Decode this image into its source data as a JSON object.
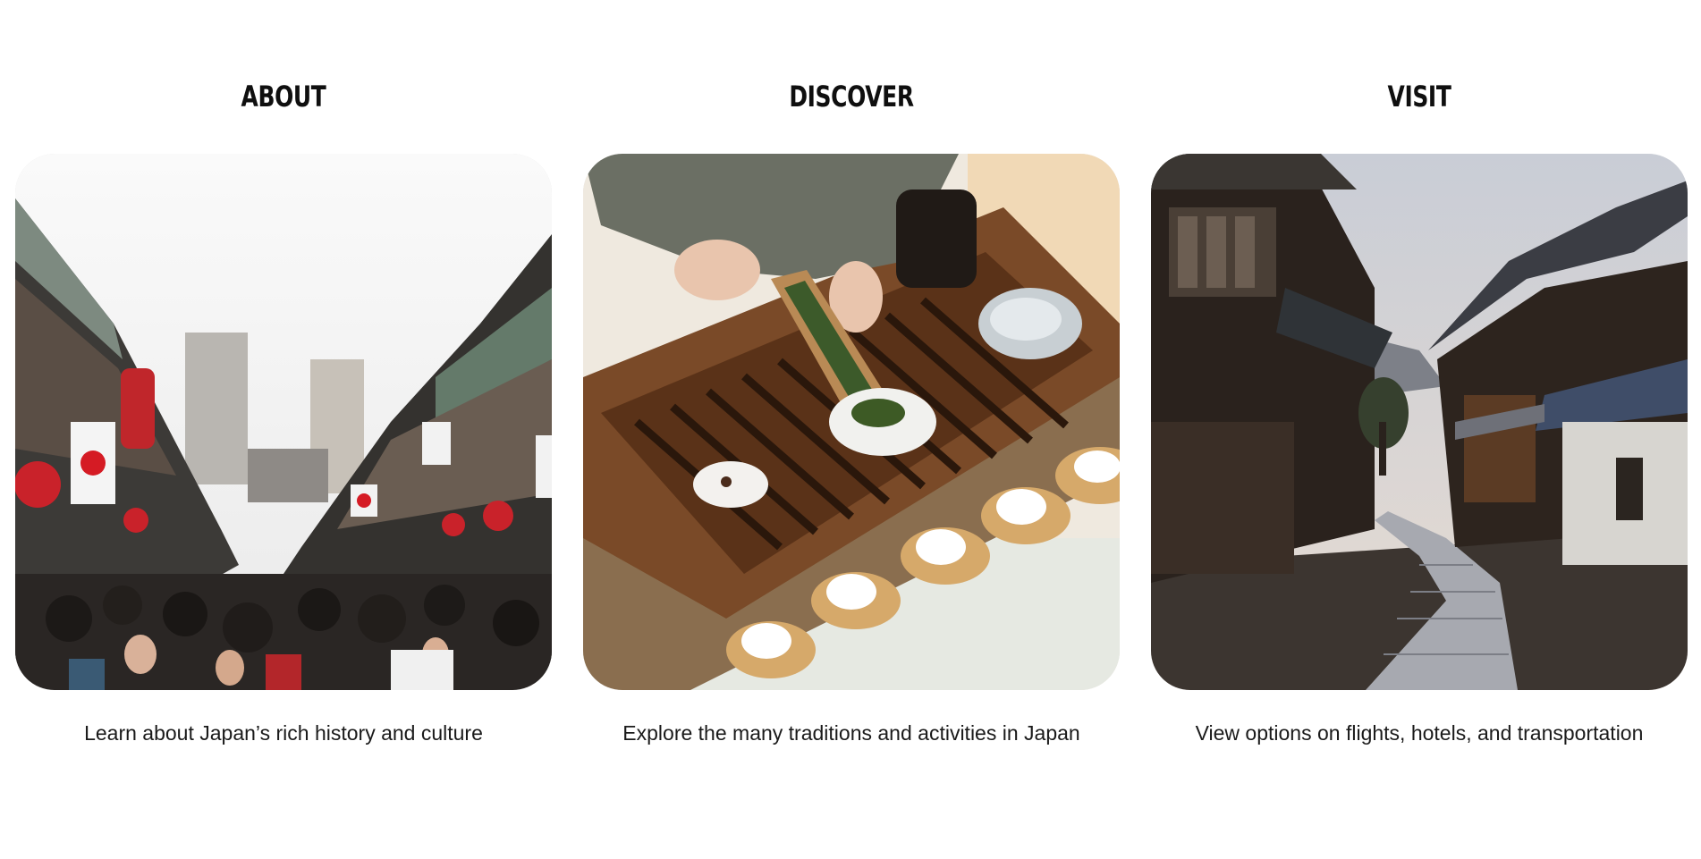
{
  "cards": [
    {
      "title": "ABOUT",
      "caption": "Learn about Japan’s rich history and culture",
      "image": "crowded-street-market-photo"
    },
    {
      "title": "DISCOVER",
      "caption": "Explore the many traditions and activities in Japan",
      "image": "tea-ceremony-photo"
    },
    {
      "title": "VISIT",
      "caption": "View options on flights, hotels, and transportation",
      "image": "traditional-village-street-photo"
    }
  ]
}
